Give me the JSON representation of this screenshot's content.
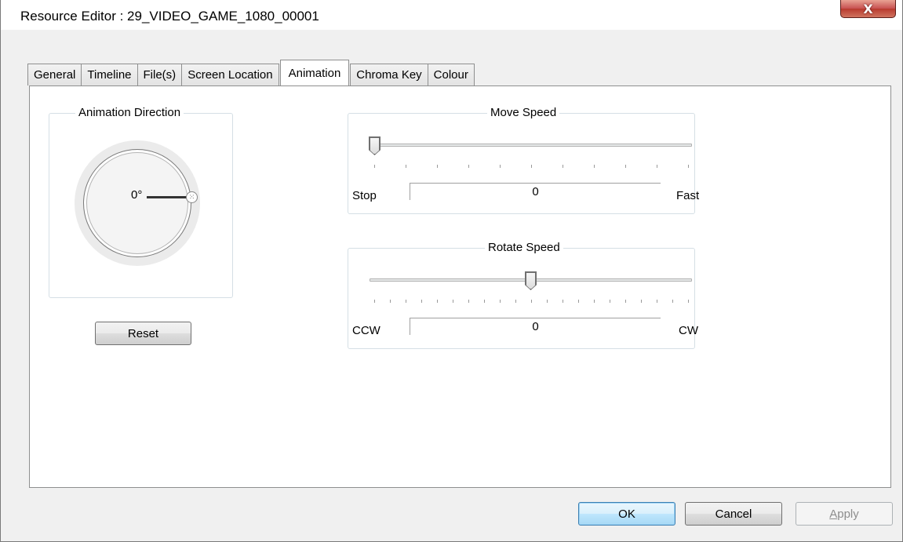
{
  "window": {
    "title": "Resource Editor  :  29_VIDEO_GAME_1080_00001",
    "close_glyph": "X"
  },
  "tabs": [
    {
      "label": "General"
    },
    {
      "label": "Timeline"
    },
    {
      "label": "File(s)"
    },
    {
      "label": "Screen Location"
    },
    {
      "label": "Animation",
      "active": true
    },
    {
      "label": "Chroma Key"
    },
    {
      "label": "Colour"
    }
  ],
  "animation_direction": {
    "group_label": "Animation Direction",
    "angle_text": "0°",
    "reset_label": "Reset"
  },
  "move_speed": {
    "group_label": "Move Speed",
    "min_label": "Stop",
    "max_label": "Fast",
    "value": "0",
    "slider_position_fraction": 0.0
  },
  "rotate_speed": {
    "group_label": "Rotate Speed",
    "min_label": "CCW",
    "max_label": "CW",
    "value": "0",
    "slider_position_fraction": 0.5
  },
  "footer": {
    "ok_label": "OK",
    "cancel_label": "Cancel",
    "apply_label_prefix": "A",
    "apply_label_rest": "pply"
  },
  "colors": {
    "active_tab_bg": "#ffffff",
    "dialog_bg": "#f0f0f0",
    "close_button": "#c75050",
    "default_button_border": "#3c7fb1"
  }
}
